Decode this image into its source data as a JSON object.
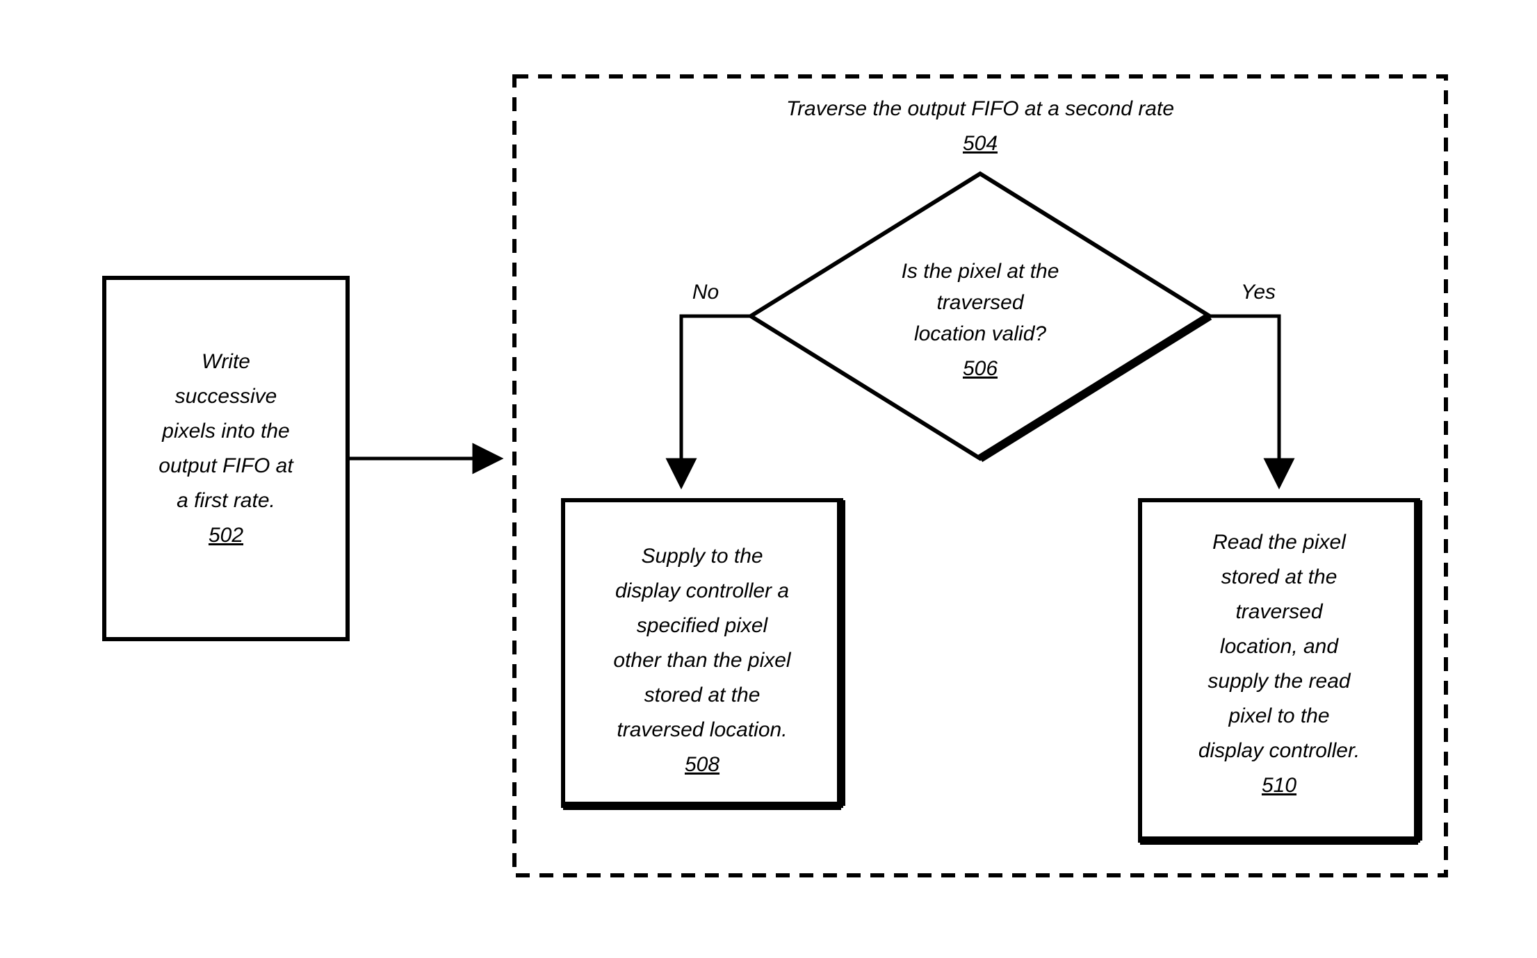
{
  "diagram": {
    "box502": {
      "line1": "Write",
      "line2": "successive",
      "line3": "pixels into the",
      "line4": "output FIFO at",
      "line5": "a first rate.",
      "ref": "502"
    },
    "container504": {
      "title": "Traverse the output FIFO at a second rate",
      "ref": "504"
    },
    "decision506": {
      "line1": "Is the pixel at the",
      "line2": "traversed",
      "line3": "location valid?",
      "ref": "506",
      "no": "No",
      "yes": "Yes"
    },
    "box508": {
      "line1": "Supply to the",
      "line2": "display controller a",
      "line3": "specified pixel",
      "line4": "other than the pixel",
      "line5": "stored at the",
      "line6": "traversed location.",
      "ref": "508"
    },
    "box510": {
      "line1": "Read the pixel",
      "line2": "stored at the",
      "line3": "traversed",
      "line4": "location, and",
      "line5": "supply the read",
      "line6": "pixel to the",
      "line7": "display controller.",
      "ref": "510"
    }
  }
}
